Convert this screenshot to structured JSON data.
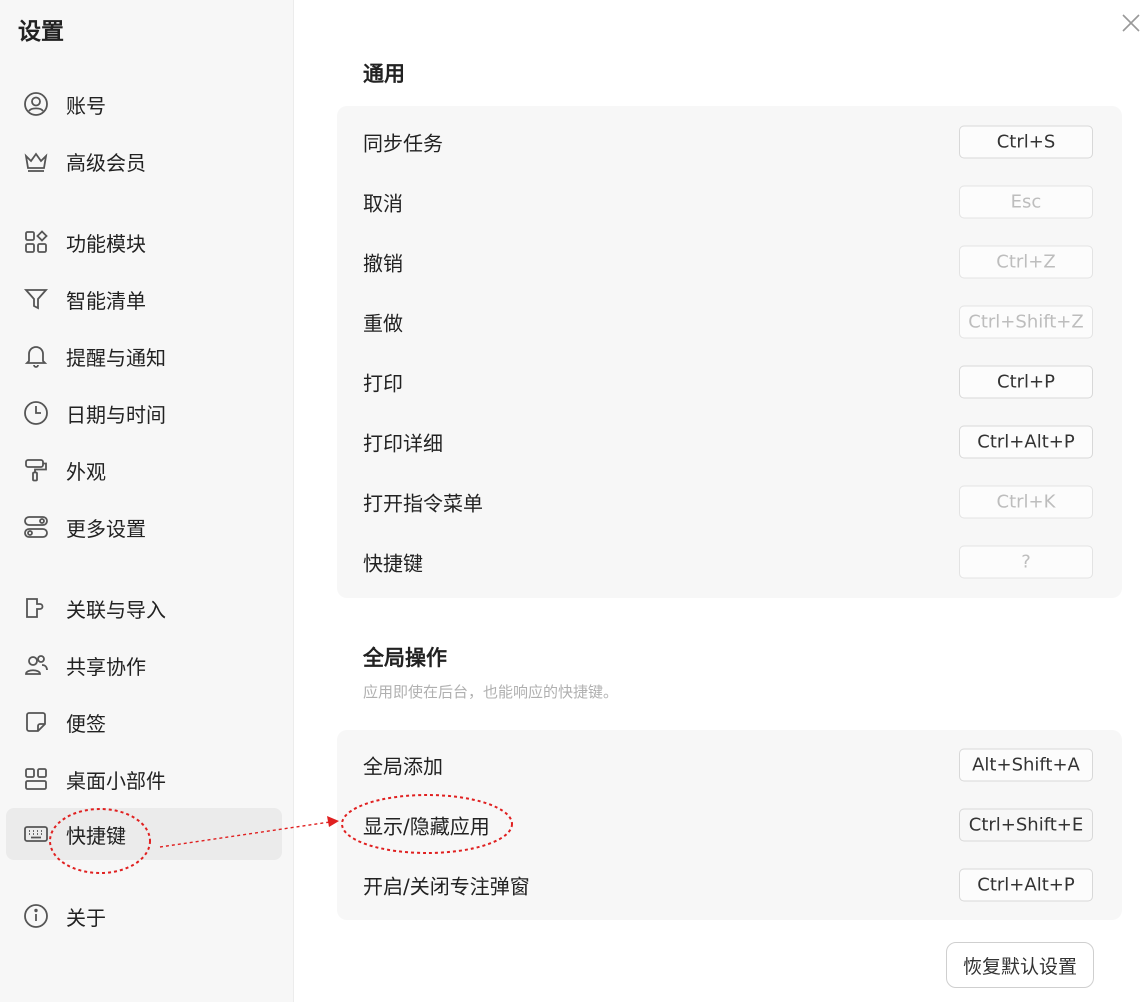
{
  "sidebar": {
    "title": "设置",
    "items": [
      {
        "label": "账号",
        "icon": "user-circle-icon"
      },
      {
        "label": "高级会员",
        "icon": "crown-icon"
      },
      {
        "label": "功能模块",
        "icon": "modules-grid-icon"
      },
      {
        "label": "智能清单",
        "icon": "filter-icon"
      },
      {
        "label": "提醒与通知",
        "icon": "bell-icon"
      },
      {
        "label": "日期与时间",
        "icon": "clock-icon"
      },
      {
        "label": "外观",
        "icon": "paint-roller-icon"
      },
      {
        "label": "更多设置",
        "icon": "toggles-icon"
      },
      {
        "label": "关联与导入",
        "icon": "integration-icon"
      },
      {
        "label": "共享协作",
        "icon": "people-icon"
      },
      {
        "label": "便签",
        "icon": "sticky-note-icon"
      },
      {
        "label": "桌面小部件",
        "icon": "widgets-icon"
      },
      {
        "label": "快捷键",
        "icon": "keyboard-icon",
        "active": true
      },
      {
        "label": "关于",
        "icon": "info-icon"
      }
    ]
  },
  "general": {
    "title": "通用",
    "rows": [
      {
        "label": "同步任务",
        "key": "Ctrl+S",
        "muted": false
      },
      {
        "label": "取消",
        "key": "Esc",
        "muted": true
      },
      {
        "label": "撤销",
        "key": "Ctrl+Z",
        "muted": true
      },
      {
        "label": "重做",
        "key": "Ctrl+Shift+Z",
        "muted": true
      },
      {
        "label": "打印",
        "key": "Ctrl+P",
        "muted": false
      },
      {
        "label": "打印详细",
        "key": "Ctrl+Alt+P",
        "muted": false
      },
      {
        "label": "打开指令菜单",
        "key": "Ctrl+K",
        "muted": true
      },
      {
        "label": "快捷键",
        "key": "?",
        "muted": true
      }
    ]
  },
  "global": {
    "title": "全局操作",
    "description": "应用即使在后台，也能响应的快捷键。",
    "rows": [
      {
        "label": "全局添加",
        "key": "Alt+Shift+A",
        "muted": false
      },
      {
        "label": "显示/隐藏应用",
        "key": "Ctrl+Shift+E",
        "muted": false
      },
      {
        "label": "开启/关闭专注弹窗",
        "key": "Ctrl+Alt+P",
        "muted": false
      }
    ]
  },
  "restore_button": "恢复默认设置",
  "colors": {
    "highlight": "#f6ff00",
    "annotation": "#e02020",
    "sidebar_bg": "#f7f7f7",
    "card_bg": "#f7f7f7"
  }
}
